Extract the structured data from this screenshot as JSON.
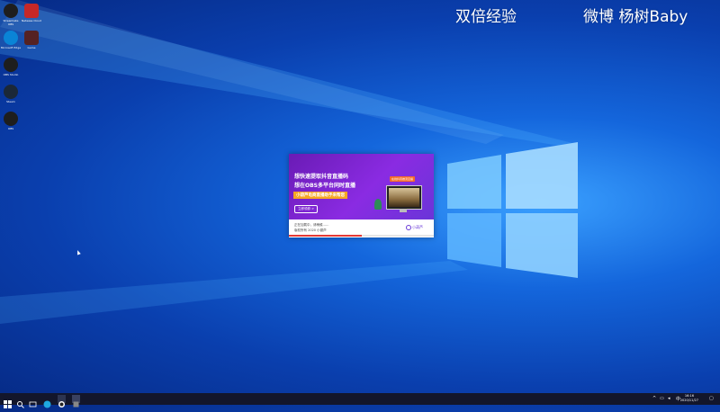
{
  "watermark": {
    "left": "双倍经验",
    "right": "微博 杨树Baby"
  },
  "desktop_icons": [
    {
      "label": "Streamlabs OBS",
      "icon": "obs-icon",
      "color": "#222"
    },
    {
      "label": "Netease Cloud",
      "icon": "app-icon",
      "color": "#c62828"
    },
    {
      "label": "Microsoft Edge",
      "icon": "edge-icon",
      "color": "#0a84d6"
    },
    {
      "label": "Game",
      "icon": "game-icon",
      "color": "#552222"
    },
    {
      "label": "OBS Studio",
      "icon": "obs-icon",
      "color": "#222"
    },
    {
      "label": "Steam",
      "icon": "steam-icon",
      "color": "#1b2838"
    },
    {
      "label": "OBS",
      "icon": "obs-icon",
      "color": "#222"
    }
  ],
  "splash": {
    "line1": "想快速提取抖音直播码",
    "line2": "想在OBS多平台同时直播",
    "badge": "小葫芦电商直播助手来帮您",
    "button": "立即领券 >",
    "tag": "在线抖音推流直播",
    "status1": "正在加载中，请稍候……",
    "status2": "版权所有 2020 小葫芦",
    "logo": "小葫芦",
    "progress": 0.5
  },
  "taskbar": {
    "start_icon": "windows-icon",
    "apps": [
      "search-icon",
      "task-view-icon",
      "edge-icon",
      "obs-icon"
    ],
    "clock_time": "16:16",
    "clock_date": "2020/11/27"
  }
}
